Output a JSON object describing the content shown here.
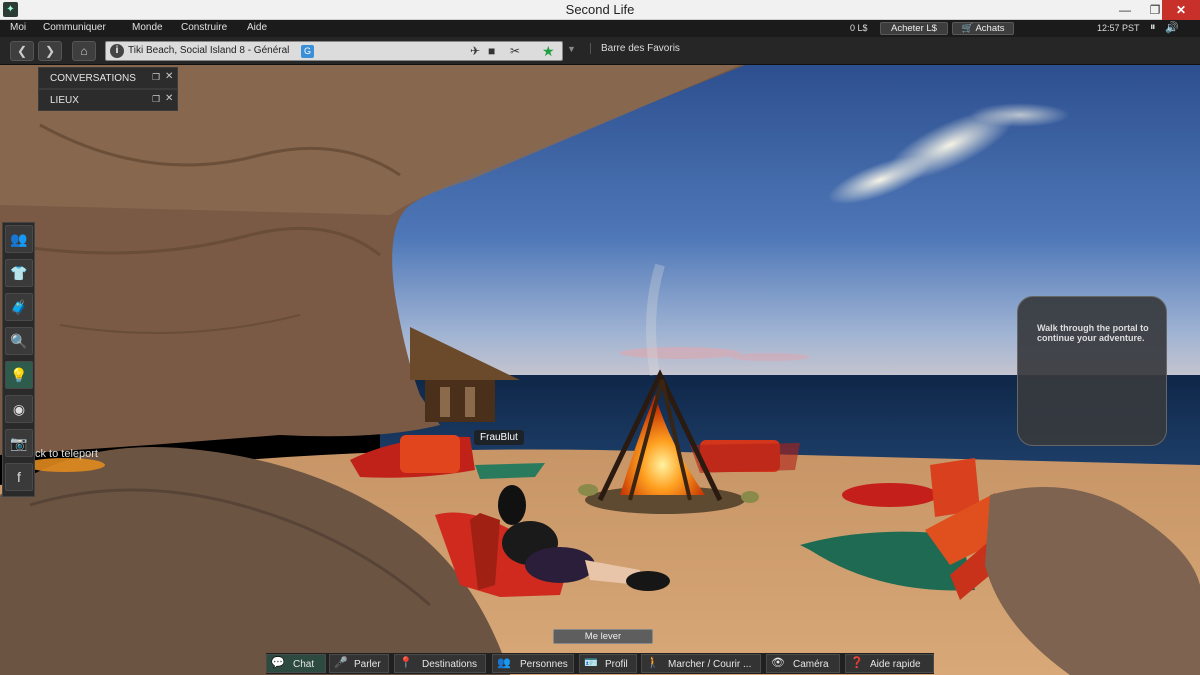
{
  "window": {
    "title": "Second Life",
    "minimize": "—",
    "maximize": "❐",
    "close": "✕"
  },
  "menubar": {
    "items": [
      "Moi",
      "Communiquer",
      "Monde",
      "Construire",
      "Aide"
    ],
    "balance": "0 L$",
    "buy_currency": "Acheter L$",
    "shop": "Achats",
    "clock": "12:57  PST",
    "pause": "⏸",
    "volume": "🔊"
  },
  "navbar": {
    "back": "❮",
    "forward": "❯",
    "home": "⌂",
    "location_info": "i",
    "location": "Tiki Beach, Social Island 8 - Général",
    "maturity_badge": "G",
    "favorites_label": "Barre des Favoris",
    "icons": [
      "no-fly-icon",
      "no-build-icon",
      "no-script-icon",
      "favorite-star-icon"
    ]
  },
  "panels": {
    "conversations": "CONVERSATIONS",
    "places": "LIEUX"
  },
  "sidebar": {
    "icons": [
      "people-icon",
      "appearance-icon",
      "inventory-icon",
      "search-icon",
      "destinations-icon",
      "voice-icon",
      "snapshot-icon",
      "facebook-icon"
    ]
  },
  "scene": {
    "teleport_text": "ck to teleport",
    "avatar_name": "FrauBlut",
    "portal_message": "Walk through the portal to continue your adventure."
  },
  "stand_up": "Me lever",
  "bottombar": {
    "buttons": [
      "Chat",
      "Parler",
      "Destinations",
      "Personnes",
      "Profil",
      "Marcher / Courir ...",
      "Caméra",
      "Aide rapide"
    ]
  },
  "colors": {
    "accent": "#2f5b4c",
    "close": "#c7312a",
    "star": "#1fa040"
  }
}
